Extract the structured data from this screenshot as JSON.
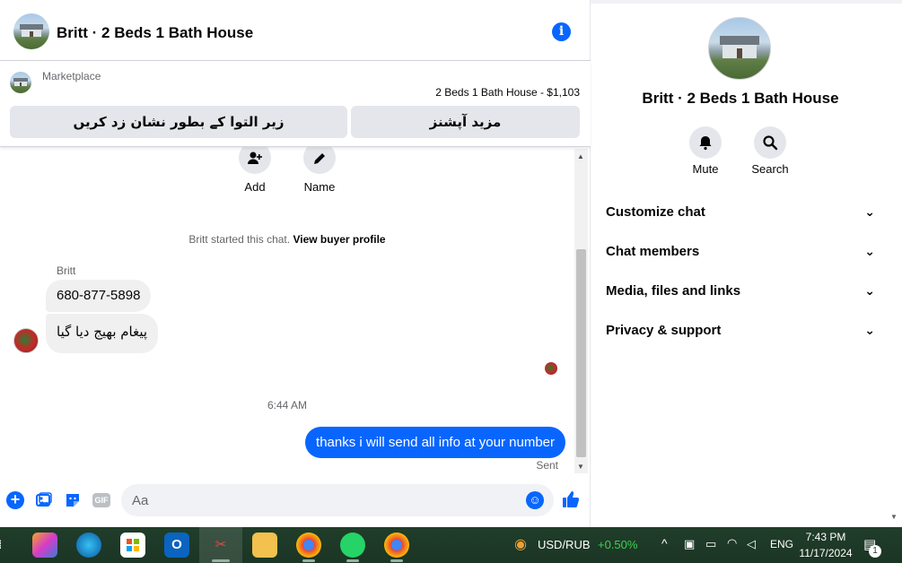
{
  "header": {
    "title": "Britt · 2 Beds 1 Bath House",
    "info_icon": "info-icon"
  },
  "marketplace": {
    "label": "Marketplace",
    "listing": "2 Beds 1 Bath House - $1,103",
    "mark_sold_button": "زیر التوا کے بطور نشان زد کریں",
    "more_options_button": "مزید آپشنز"
  },
  "actions": {
    "add_label": "Add",
    "name_label": "Name"
  },
  "conversation": {
    "started_text": "Britt started this chat.",
    "view_profile_link": "View buyer profile",
    "sender_name": "Britt",
    "incoming": [
      "680-877-5898",
      "پیغام بھیج دیا گیا"
    ],
    "timestamp": "6:44 AM",
    "outgoing": "thanks i will send all info at your number",
    "status": "Sent"
  },
  "composer": {
    "placeholder": "Aa",
    "gif_label": "GIF"
  },
  "side_panel": {
    "title": "Britt · 2 Beds 1 Bath House",
    "mute_label": "Mute",
    "search_label": "Search",
    "sections": [
      "Customize chat",
      "Chat members",
      "Media, files and links",
      "Privacy & support"
    ]
  },
  "taskbar": {
    "ticker": "USD/RUB",
    "ticker_change": "+0.50%",
    "language": "ENG",
    "time": "7:43 PM",
    "date": "11/17/2024",
    "notification_count": "1"
  },
  "colors": {
    "accent": "#0866ff",
    "bubble_in": "#f0f0f0",
    "taskbar": "#1f3a28",
    "positive": "#39d353"
  }
}
